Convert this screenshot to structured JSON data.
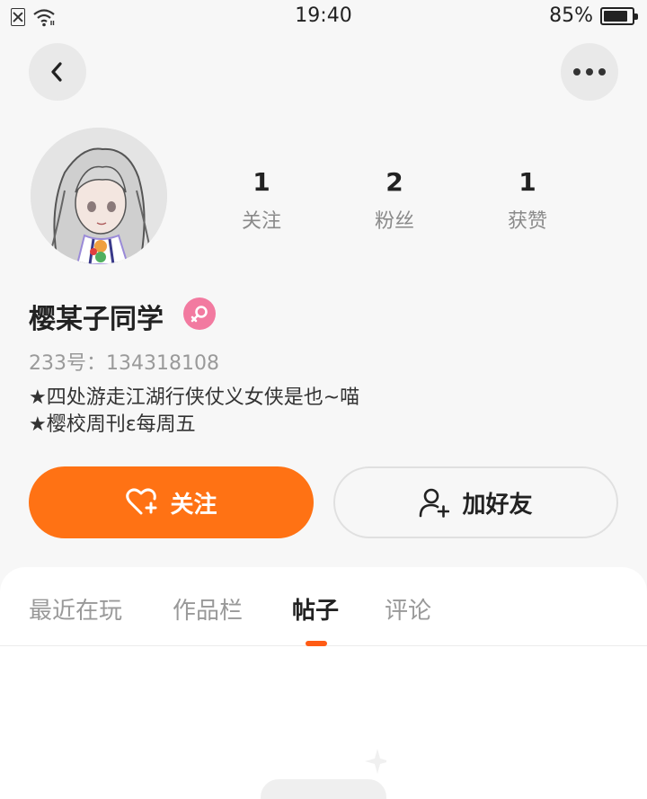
{
  "status_bar": {
    "time": "19:40",
    "battery": "85%",
    "battery_level": 0.85
  },
  "nav": {
    "back_icon": "chevron-left-icon",
    "more_icon": "more-dots-icon"
  },
  "profile": {
    "stats": [
      {
        "value": "1",
        "label": "关注"
      },
      {
        "value": "2",
        "label": "粉丝"
      },
      {
        "value": "1",
        "label": "获赞"
      }
    ],
    "name": "樱某子同学",
    "gender_icon": "female-icon",
    "uid": "233号：134318108",
    "bio": [
      "★四处游走江湖行侠仗义女侠是也~喵",
      "★樱校周刊ɛ每周五"
    ]
  },
  "actions": {
    "follow_label": "关注",
    "follow_icon": "heart-plus-icon",
    "add_friend_label": "加好友",
    "add_friend_icon": "add-user-icon"
  },
  "tabs": {
    "items": [
      {
        "label": "最近在玩"
      },
      {
        "label": "作品栏"
      },
      {
        "label": "帖子"
      },
      {
        "label": "评论"
      }
    ],
    "active_index": 2
  },
  "colors": {
    "accent": "#ff7214",
    "tab_indicator": "#ff5b14",
    "gender_badge": "#f27aa0"
  }
}
